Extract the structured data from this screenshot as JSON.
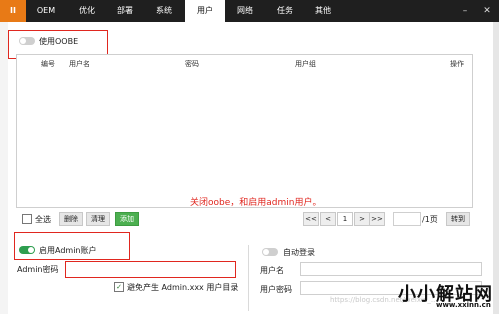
{
  "tabs": [
    {
      "label": "II"
    },
    {
      "label": "OEM"
    },
    {
      "label": "优化"
    },
    {
      "label": "部署"
    },
    {
      "label": "系统"
    },
    {
      "label": "用户"
    },
    {
      "label": "网络"
    },
    {
      "label": "任务"
    },
    {
      "label": "其他"
    }
  ],
  "window_controls": {
    "minimize": "–",
    "close": "✕"
  },
  "oobe": {
    "toggle_label": "使用OOBE",
    "enabled": false
  },
  "table": {
    "headers": {
      "id": "编号",
      "username": "用户名",
      "password": "密码",
      "group": "用户组",
      "actions": "操作"
    }
  },
  "annotation": "关闭oobe，和启用admin用户。",
  "toolbar": {
    "select_all": "全选",
    "delete": "删除",
    "clear": "清理",
    "add": "添加",
    "pager": {
      "first": "<<",
      "prev": "<",
      "current": "1",
      "next": ">",
      "last": ">>"
    },
    "total_pages": "/1页",
    "goto": "转到"
  },
  "admin": {
    "toggle_label": "启用Admin账户",
    "enabled": true,
    "password_label": "Admin密码",
    "avoid_label": "避免产生 Admin.xxx 用户目录",
    "avoid_checked": true
  },
  "autologin": {
    "toggle_label": "自动登录",
    "enabled": false,
    "username_label": "用户名",
    "password_label": "用户密码"
  },
  "watermark": "https://blog.csdn.net/weixin_...",
  "logo": {
    "text": "小小解站网",
    "url": "www.xxinn.cn"
  }
}
